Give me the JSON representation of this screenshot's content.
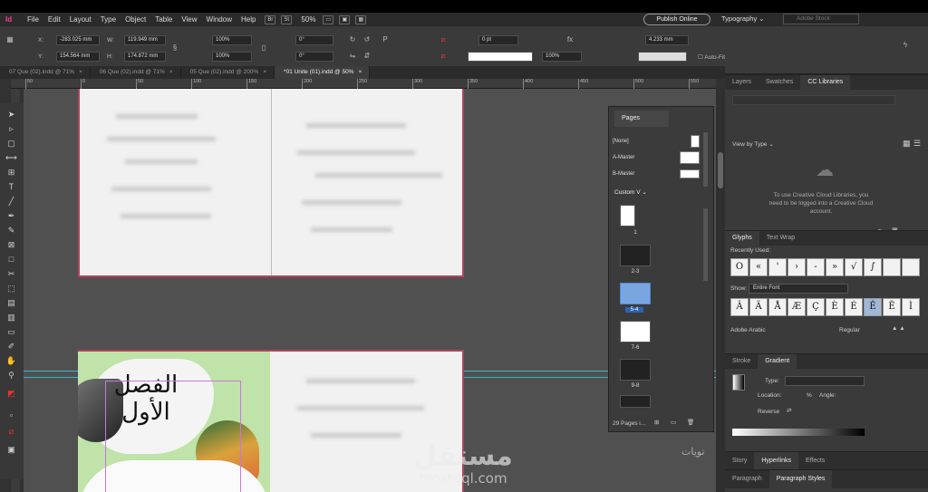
{
  "menu": {
    "app_icon": "Id",
    "items": [
      "File",
      "Edit",
      "Layout",
      "Type",
      "Object",
      "Table",
      "View",
      "Window",
      "Help"
    ],
    "bridge_label": "Br",
    "stock_label": "St",
    "zoom": "50%",
    "publish_online": "Publish Online",
    "workspace": "Typography",
    "search_placeholder": "Adobe Stock"
  },
  "control": {
    "x_label": "X:",
    "x_value": "-283.025 mm",
    "y_label": "Y:",
    "y_value": "154.564 mm",
    "w_label": "W:",
    "w_value": "119.949 mm",
    "h_label": "H:",
    "h_value": "174.872 mm",
    "scale_x": "100%",
    "scale_y": "100%",
    "rotate": "0°",
    "shear": "0°",
    "stroke_weight": "0 pt",
    "opacity": "100%",
    "size": "4.233 mm",
    "autofit": "Auto-Fit"
  },
  "tabs": [
    {
      "label": "07 Que (02).indd @ 71%",
      "close": "×"
    },
    {
      "label": "06 Que (02).indd @ 71%",
      "close": "×"
    },
    {
      "label": "05 Que (02).indd @ 200%",
      "close": "×"
    },
    {
      "label": "*01 Unite (01).indd @ 50%",
      "close": "×"
    }
  ],
  "ruler_ticks": [
    "50",
    "0",
    "50",
    "100",
    "150",
    "200",
    "250",
    "300",
    "350",
    "400",
    "450",
    "500",
    "550"
  ],
  "cover": {
    "title_line1": "الفصل",
    "title_line2": "الأول"
  },
  "watermark": {
    "arabic": "مستقل",
    "latin": "mostaql.com"
  },
  "side_text": "تويات",
  "pages_panel": {
    "tab": "Pages",
    "masters": [
      "[None]",
      "A-Master",
      "B-Master"
    ],
    "section": "Custom V",
    "pages": [
      "1",
      "2-3",
      "5-4",
      "7-6",
      "9-8"
    ],
    "footer": "29 Pages i..."
  },
  "cc_panel": {
    "tabs": [
      "Layers",
      "Swatches",
      "CC Libraries"
    ],
    "view_by": "View by Type",
    "message": "To use Creative Cloud Libraries, you need to be logged into a Creative Cloud account."
  },
  "glyphs_panel": {
    "tabs": [
      "Glyphs",
      "Text Wrap"
    ],
    "recently_used": "Recently Used:",
    "recent": [
      "O",
      "«",
      "'",
      "›",
      "-",
      "»",
      "√",
      "∫",
      "",
      ""
    ],
    "show_label": "Show:",
    "show_value": "Entire Font",
    "glyphs": [
      "Â",
      "Ä",
      "Å",
      "Æ",
      "Ç",
      "È",
      "É",
      "Ê",
      "Ë",
      "Ì"
    ],
    "font": "Adobe Arabic",
    "style": "Regular"
  },
  "gradient_panel": {
    "tabs": [
      "Stroke",
      "Gradient"
    ],
    "type_label": "Type:",
    "location_label": "Location:",
    "percent": "%",
    "angle_label": "Angle:",
    "reverse_label": "Reverse"
  },
  "bottom_panels": {
    "row1": [
      "Story",
      "Hyperlinks",
      "Effects"
    ],
    "row2": [
      "Paragraph",
      "Paragraph Styles"
    ]
  }
}
